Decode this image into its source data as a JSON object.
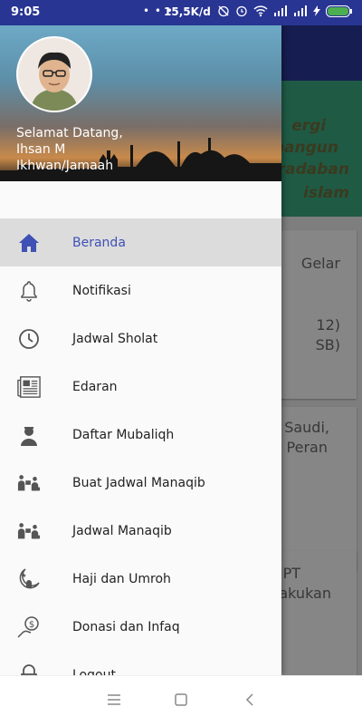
{
  "status_bar": {
    "time": "9:05",
    "dots": "• • •",
    "network_speed": "15,5K/d",
    "icons": [
      "alarm-off-icon",
      "alarm-icon",
      "wifi-icon",
      "signal-icon",
      "signal-icon",
      "charging-icon",
      "battery-icon"
    ],
    "battery_color": "#4caf50"
  },
  "drawer": {
    "welcome_line1": "Selamat Datang,",
    "welcome_line2": "Ihsan M",
    "welcome_line3": "Ikhwan/Jamaah",
    "accent": "#3f51b5",
    "items": [
      {
        "label": "Beranda",
        "icon": "home-icon",
        "active": true
      },
      {
        "label": "Notifikasi",
        "icon": "bell-icon"
      },
      {
        "label": "Jadwal Sholat",
        "icon": "clock-icon"
      },
      {
        "label": "Edaran",
        "icon": "newspaper-icon"
      },
      {
        "label": "Daftar Mubaliqh",
        "icon": "person-icon"
      },
      {
        "label": "Buat Jadwal Manaqib",
        "icon": "manaqib-icon"
      },
      {
        "label": "Jadwal Manaqib",
        "icon": "manaqib-icon"
      },
      {
        "label": "Haji dan Umroh",
        "icon": "mosque-icon"
      },
      {
        "label": "Donasi dan Infaq",
        "icon": "donation-icon"
      },
      {
        "label": "Logout",
        "icon": "lock-icon"
      }
    ]
  },
  "background": {
    "banner_lines": [
      "ergi",
      "bangun",
      "eradaban",
      "islam"
    ],
    "card1_lines": [
      "Gelar",
      "",
      "12)",
      "SB)"
    ],
    "card2_lines": [
      "Saudi,",
      "Peran"
    ],
    "card3_lines": [
      "PT",
      "akukan"
    ]
  }
}
